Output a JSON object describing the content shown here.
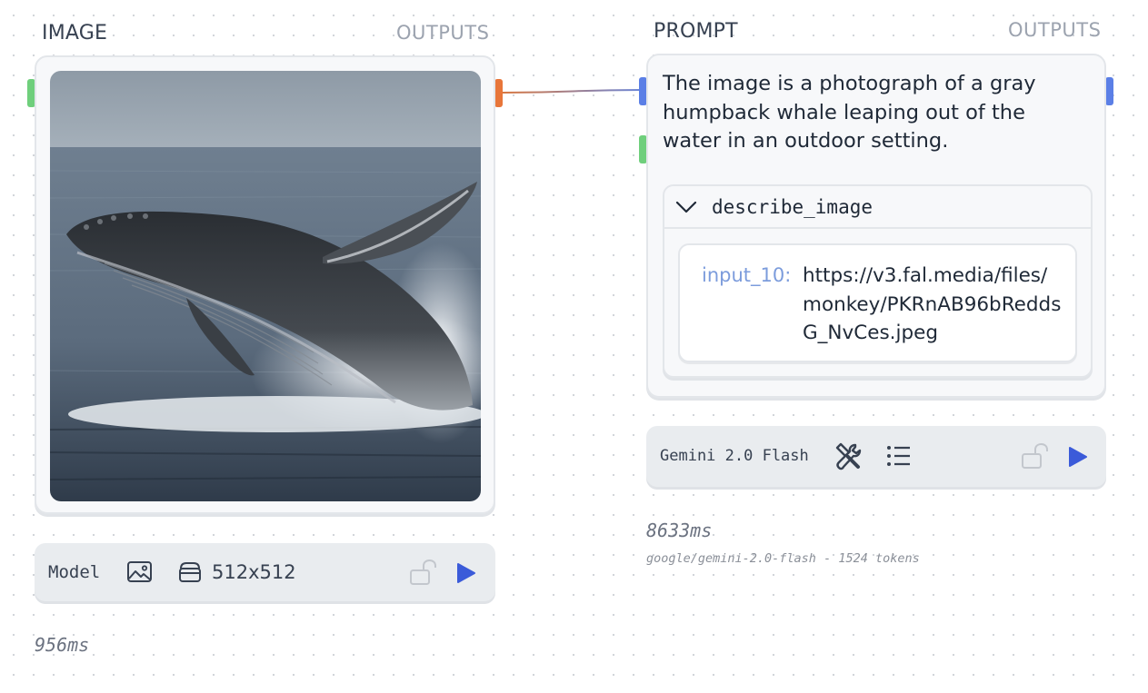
{
  "image_node": {
    "title": "IMAGE",
    "outputs_label": "OUTPUTS",
    "image_alt": "Photograph of a gray humpback whale leaping out of the water",
    "toolbar": {
      "model_label": "Model",
      "image_icon": "image-icon",
      "size_icon": "layers-icon",
      "size_value": "512x512",
      "lock_icon": "unlock-icon",
      "run_icon": "play-icon"
    },
    "timing": "956ms"
  },
  "prompt_node": {
    "title": "PROMPT",
    "outputs_label": "OUTPUTS",
    "text": "The image is a photograph of a gray humpback whale leaping out of the water in an outdoor setting.",
    "tool_call": {
      "name": "describe_image",
      "expand_icon": "chevron-down-icon",
      "arg_key": "input_10:",
      "arg_value": "https://v3.fal.media/files/monkey/PKRnAB96bReddsG_NvCes.jpeg"
    },
    "toolbar": {
      "model_label": "Gemini 2.0 Flash",
      "tools_icon": "wrench-screwdriver-icon",
      "list_icon": "list-icon",
      "lock_icon": "unlock-icon",
      "run_icon": "play-icon"
    },
    "timing": "8633ms",
    "meta": "google/gemini-2.0-flash - 1524 tokens"
  },
  "colors": {
    "handle_green": "#6fcf7c",
    "handle_orange": "#e8763a",
    "handle_blue": "#5b7fe6",
    "play_blue": "#3b5bd9",
    "accent_key": "#7c9cdc"
  }
}
